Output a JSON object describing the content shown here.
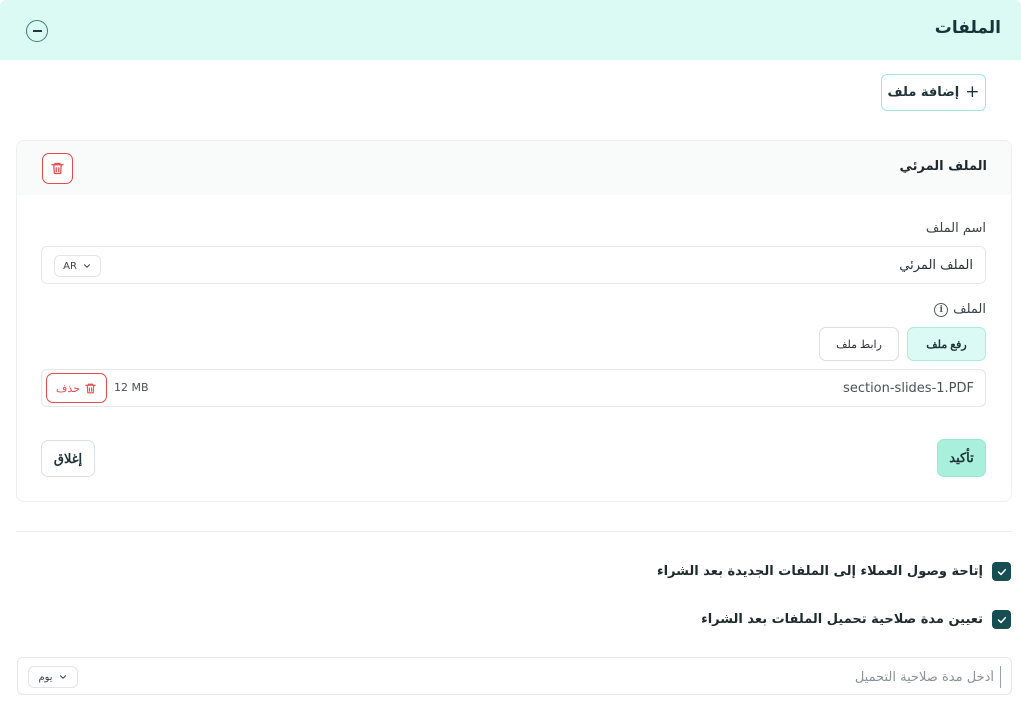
{
  "section": {
    "title": "الملفات"
  },
  "add_file": {
    "label": "إضافة ملف"
  },
  "file_card": {
    "title": "الملف المرئي",
    "name_label": "اسم الملف",
    "name_value": "الملف المرئي",
    "lang": "AR",
    "file_label": "الملف",
    "tabs": {
      "upload": "رفع ملف",
      "link": "رابط ملف"
    },
    "uploaded": {
      "name": "section-slides-1.PDF",
      "size": "12 MB",
      "delete_label": "حذف"
    },
    "confirm_label": "تأكيد",
    "close_label": "إغلاق"
  },
  "options": {
    "allow_access": "إتاحة وصول العملاء إلى الملفات الجديدة بعد الشراء",
    "set_validity": "تعيين مدة صلاحية تحميل الملفات بعد الشراء"
  },
  "validity": {
    "placeholder": "أدخل مدة صلاحية التحميل",
    "unit": "يوم"
  },
  "colors": {
    "accent": "#dbfaf3",
    "danger": "#e5484d",
    "checkbox": "#164e52"
  },
  "icons": {
    "collapse": "minus-circle-icon",
    "add": "plus-icon",
    "trash": "trash-icon",
    "info": "info-icon",
    "chevron": "chevron-down-icon",
    "check": "check-icon"
  }
}
